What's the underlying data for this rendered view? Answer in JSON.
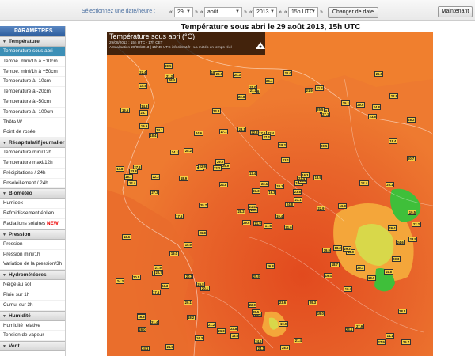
{
  "toolbar": {
    "select_label": "Sélectionnez une date/heure :",
    "day": "29",
    "month": "août",
    "year": "2013",
    "hour": "15h UTC",
    "change_button": "Changer de date",
    "now_button": "Maintenant",
    "prev_glyph": "«",
    "next_glyph": "»"
  },
  "sidebar": {
    "header": "PARAMÈTRES",
    "sections": [
      {
        "title": "Température",
        "items": [
          "Température sous abri",
          "Tempé. mini/1h à +10cm",
          "Tempé. mini/1h à +50cm",
          "Température à -10cm",
          "Température à -20cm",
          "Température à -50cm",
          "Température à -100cm",
          "Thêta W",
          "Point de rosée"
        ]
      },
      {
        "title": "Récapitulatif journalier",
        "items": [
          "Température mini/12h",
          "Température maxi/12h",
          "Précipitations / 24h",
          "Ensoleillement / 24h"
        ]
      },
      {
        "title": "Biométéo",
        "items": [
          "Humidex",
          "Refroidissement éolien",
          "Radiations solaires"
        ]
      },
      {
        "title": "Pression",
        "items": [
          "Pression",
          "Pression mini/1h",
          "Variation de la pression/3h"
        ]
      },
      {
        "title": "Hydrométéores",
        "items": [
          "Neige au sol",
          "Pluie sur 1h",
          "Cumul sur 3h"
        ]
      },
      {
        "title": "Humidité",
        "items": [
          "Humidité relative",
          "Tension de vapeur"
        ]
      },
      {
        "title": "Vent",
        "items": []
      }
    ],
    "active_item": "Température sous abri",
    "new_badge": "NEW"
  },
  "map": {
    "title": "Température sous abri le 29 août 2013, 15h UTC",
    "legend_title": "Température sous abri (°C)",
    "legend_line1": "29/08/2013 : 15h UTC - 17h CET",
    "legend_line2": "Actualisation 29/08/2013 | 15h45 UTC   infoclimat.fr - La météo en temps réel",
    "station_values": [
      "17.6",
      "18.4",
      "19.5",
      "18.7",
      "19.0",
      "20.1",
      "21.2",
      "22.4",
      "23.6",
      "24.8",
      "26.4",
      "25.7",
      "27.3",
      "28.2",
      "29.6",
      "20.5",
      "21.9",
      "22.8",
      "23.1",
      "24.3",
      "25.9",
      "26.0",
      "18.2",
      "17.1",
      "16.8",
      "15.9",
      "14.1",
      "13.6",
      "12.4",
      "19.9",
      "20.7",
      "21.4",
      "22.9",
      "23.3",
      "24.6",
      "25.1",
      "26.8",
      "27.9",
      "28.5",
      "29.3",
      "21.0",
      "22.2",
      "18.9",
      "19.4",
      "16.3",
      "14.8",
      "23.8",
      "24.1",
      "25.5",
      "27.1"
    ]
  },
  "colors": {
    "accent": "#2f5f9f",
    "active_item": "#3c8fb6",
    "map_hot": "#e8642a",
    "map_warm": "#f0822e",
    "map_mild": "#f4a63a",
    "map_cool": "#3fbf3a"
  }
}
